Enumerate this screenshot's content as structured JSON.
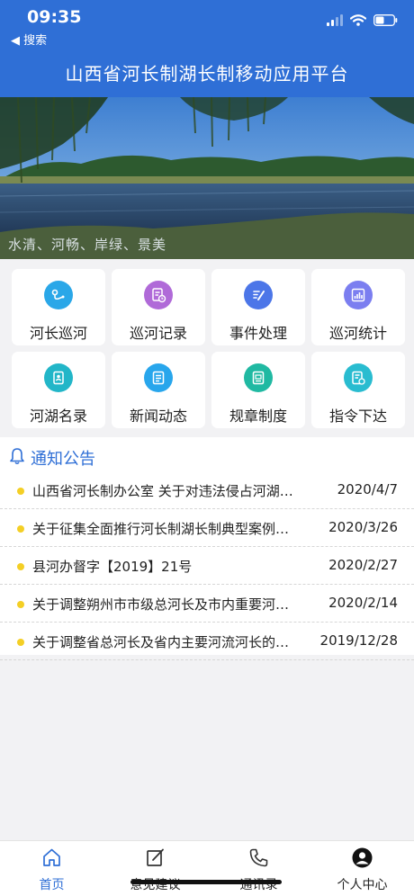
{
  "status_bar": {
    "time": "09:35",
    "back_label": "◀ 搜索"
  },
  "header": {
    "title": "山西省河长制湖长制移动应用平台"
  },
  "banner": {
    "caption": "水清、河畅、岸绿、景美"
  },
  "modules": [
    {
      "label": "河长巡河",
      "icon": "patrol-route-icon",
      "color": "#2aa7e8"
    },
    {
      "label": "巡河记录",
      "icon": "record-clock-icon",
      "color": "#b06ad8"
    },
    {
      "label": "事件处理",
      "icon": "task-edit-icon",
      "color": "#4c76e8"
    },
    {
      "label": "巡河统计",
      "icon": "statistics-icon",
      "color": "#7b7ef0"
    },
    {
      "label": "河湖名录",
      "icon": "directory-book-icon",
      "color": "#22b6c8"
    },
    {
      "label": "新闻动态",
      "icon": "news-list-icon",
      "color": "#28a6ec"
    },
    {
      "label": "规章制度",
      "icon": "regulation-doc-icon",
      "color": "#20b9a2"
    },
    {
      "label": "指令下达",
      "icon": "command-doc-icon",
      "color": "#29bcd0"
    }
  ],
  "notice": {
    "title": "通知公告",
    "items": [
      {
        "text": "山西省河长制办公室 关于对违法侵占河湖问题的通报",
        "date": "2020/4/7"
      },
      {
        "text": "关于征集全面推行河长制湖长制典型案例的通知",
        "date": "2020/3/26"
      },
      {
        "text": "县河办督字【2019】21号",
        "date": "2020/2/27"
      },
      {
        "text": "关于调整朔州市市级总河长及市内重要河流河长的通知",
        "date": "2020/2/14"
      },
      {
        "text": "关于调整省总河长及省内主要河流河长的通知",
        "date": "2019/12/28"
      }
    ]
  },
  "tabbar": {
    "items": [
      {
        "label": "首页",
        "icon": "home-icon",
        "active": true
      },
      {
        "label": "意见建议",
        "icon": "feedback-edit-icon",
        "active": false
      },
      {
        "label": "通讯录",
        "icon": "phone-icon",
        "active": false
      },
      {
        "label": "个人中心",
        "icon": "user-icon",
        "active": false
      }
    ]
  },
  "colors": {
    "header": "#2f6fd6",
    "accent": "#2f6fd6",
    "bullet": "#f4cf25"
  }
}
